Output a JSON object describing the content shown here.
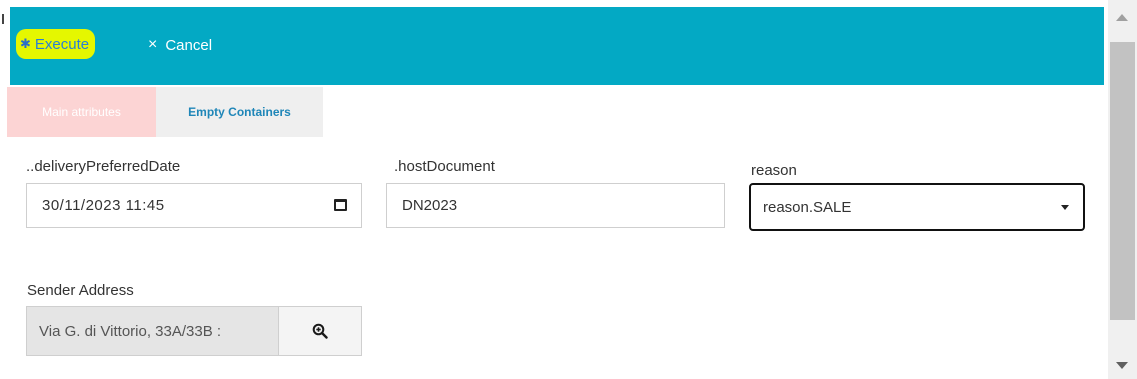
{
  "toolbar": {
    "execute_label": "Execute",
    "cancel_label": "Cancel",
    "cancel_glyph": "×",
    "execute_glyph": "✱",
    "bg_color": "#03a9c4",
    "highlight_color": "#e5f700"
  },
  "tabs": [
    {
      "label": "Main attributes",
      "active": true
    },
    {
      "label": "Empty Containers",
      "active": false
    }
  ],
  "fields": {
    "delivery": {
      "label": "..deliveryPreferredDate",
      "value": "30/11/2023 11:45"
    },
    "host": {
      "label": ".hostDocument",
      "value": "DN2023"
    },
    "reason": {
      "label": "reason",
      "value": "reason.SALE"
    },
    "sender": {
      "label": "Sender Address",
      "value": "Via G. di Vittorio, 33A/33B :"
    }
  },
  "icons": {
    "calendar": "calendar-icon",
    "zoom": "zoom-in-icon",
    "dropdown": "chevron-down-icon"
  }
}
